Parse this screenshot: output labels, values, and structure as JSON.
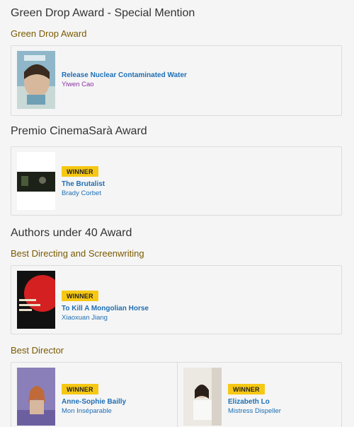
{
  "sections": [
    {
      "award": "Green Drop Award - Special Mention",
      "category": "Green Drop Award",
      "entries": [
        {
          "badge": "",
          "title": "Release Nuclear Contaminated Water",
          "subtitle": "Yiwen Cao"
        }
      ]
    },
    {
      "award": "Premio CinemaSarà Award",
      "category": "",
      "entries": [
        {
          "badge": "WINNER",
          "title": "The Brutalist",
          "subtitle": "Brady Corbet"
        }
      ]
    },
    {
      "award": "Authors under 40 Award",
      "category": "Best Directing and Screenwriting",
      "entries": [
        {
          "badge": "WINNER",
          "title": "To Kill A Mongolian Horse",
          "subtitle": "Xiaoxuan Jiang"
        }
      ]
    },
    {
      "award": "",
      "category": "Best Director",
      "entries": [
        {
          "badge": "WINNER",
          "title": "Anne-Sophie Bailly",
          "subtitle": "Mon Inséparable"
        },
        {
          "badge": "WINNER",
          "title": "Elizabeth Lo",
          "subtitle": "Mistress Dispeller"
        }
      ]
    }
  ],
  "colors": {
    "badge": "#f6c814",
    "link": "#1e6fb5",
    "category": "#7a5a00",
    "person": "#8b2fa3"
  }
}
